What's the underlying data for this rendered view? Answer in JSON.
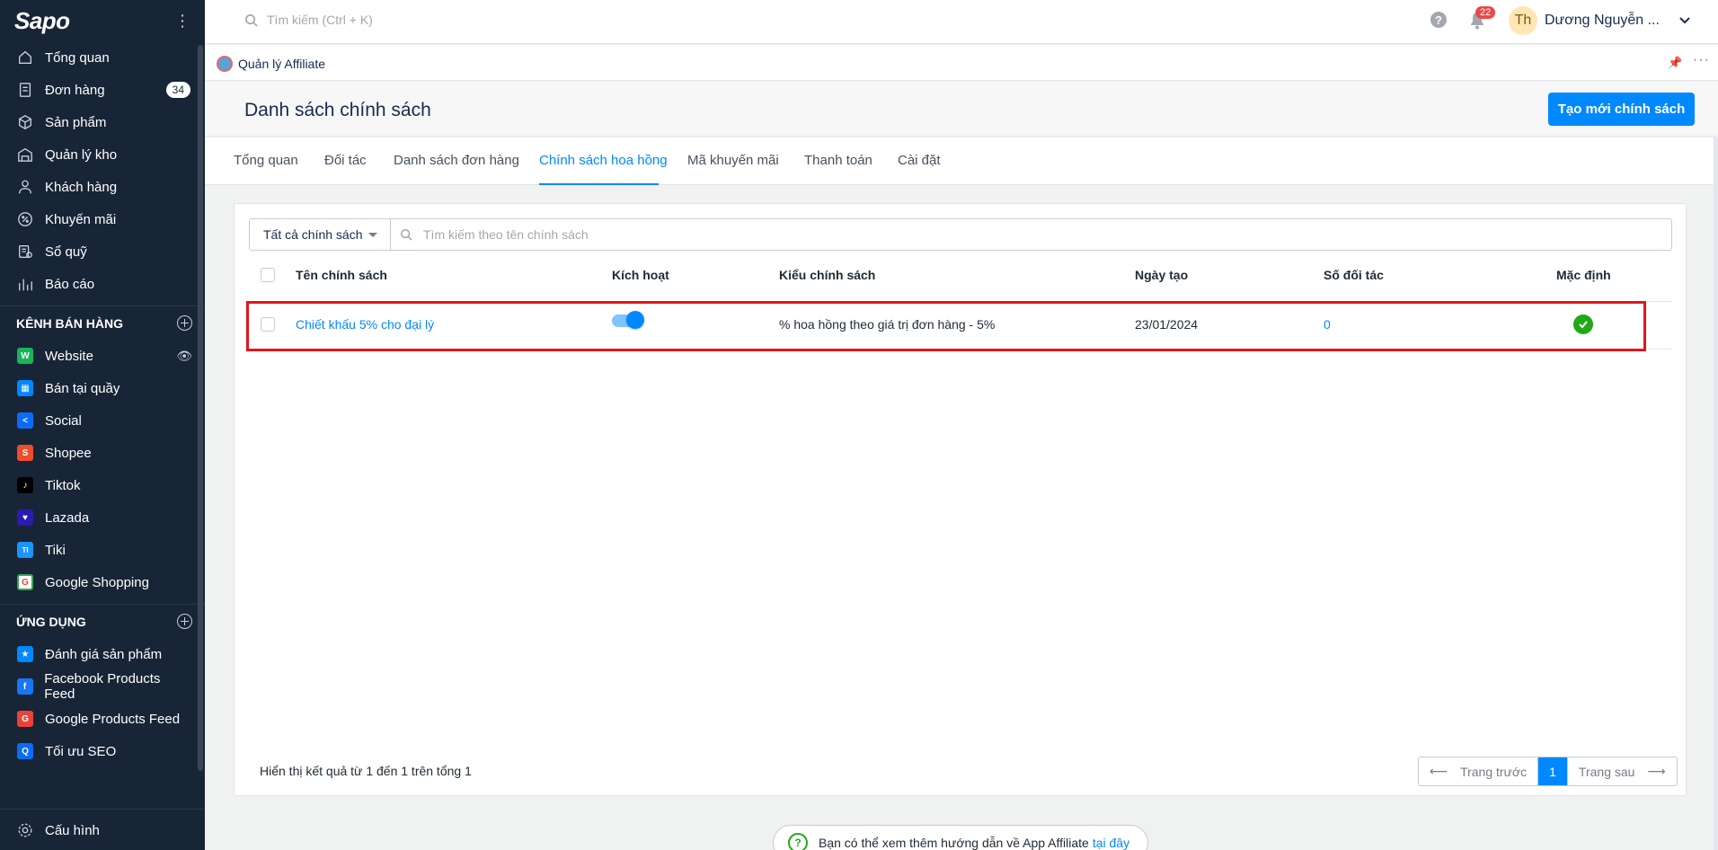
{
  "app": {
    "logo": "Sapo",
    "search_placeholder": "Tìm kiếm (Ctrl + K)"
  },
  "sidebar": {
    "main": [
      {
        "label": "Tổng quan",
        "icon": "home-icon"
      },
      {
        "label": "Đơn hàng",
        "icon": "order-icon",
        "badge": "34"
      },
      {
        "label": "Sản phẩm",
        "icon": "box-icon"
      },
      {
        "label": "Quản lý kho",
        "icon": "warehouse-icon"
      },
      {
        "label": "Khách hàng",
        "icon": "user-icon"
      },
      {
        "label": "Khuyến mãi",
        "icon": "discount-icon"
      },
      {
        "label": "Sổ quỹ",
        "icon": "cashbook-icon"
      },
      {
        "label": "Báo cáo",
        "icon": "chart-icon"
      }
    ],
    "channels_title": "KÊNH BÁN HÀNG",
    "channels": [
      {
        "label": "Website",
        "color": "#19b35a",
        "glyph": "W"
      },
      {
        "label": "Bán tại quầy",
        "color": "#0088ff",
        "glyph": "P"
      },
      {
        "label": "Social",
        "color": "#0a6cf5",
        "glyph": "<"
      },
      {
        "label": "Shopee",
        "color": "#ee4d2d",
        "glyph": "S"
      },
      {
        "label": "Tiktok",
        "color": "#000000",
        "glyph": "♪"
      },
      {
        "label": "Lazada",
        "color": "#2b1bb0",
        "glyph": "L"
      },
      {
        "label": "Tiki",
        "color": "#1a94ff",
        "glyph": "TI"
      },
      {
        "label": "Google Shopping",
        "color": "#ffffff",
        "glyph": "G"
      }
    ],
    "apps_title": "ỨNG DỤNG",
    "apps": [
      {
        "label": "Đánh giá sản phẩm",
        "color": "#0088ff",
        "glyph": "★"
      },
      {
        "label": "Facebook Products Feed",
        "color": "#1877f2",
        "glyph": "f"
      },
      {
        "label": "Google Products Feed",
        "color": "#ea4335",
        "glyph": "G"
      },
      {
        "label": "Tối ưu SEO",
        "color": "#0a6cf5",
        "glyph": "Q"
      }
    ],
    "settings": "Cấu hình"
  },
  "topbar": {
    "notifications": "22",
    "avatar": "Th",
    "user": "Dương Nguyễn ..."
  },
  "appbar": {
    "title": "Quản lý Affiliate"
  },
  "page": {
    "title": "Danh sách chính sách",
    "create_button": "Tạo mới chính sách"
  },
  "tabs": [
    "Tổng quan",
    "Đối tác",
    "Danh sách đơn hàng",
    "Chính sách hoa hồng",
    "Mã khuyến mãi",
    "Thanh toán",
    "Cài đặt"
  ],
  "active_tab": "Chính sách hoa hồng",
  "filter": {
    "dropdown": "Tất cả chính sách",
    "search_placeholder": "Tìm kiếm theo tên chính sách"
  },
  "table": {
    "headers": [
      "Tên chính sách",
      "Kích hoạt",
      "Kiểu chính sách",
      "Ngày tạo",
      "Số đối tác",
      "Mặc định"
    ],
    "rows": [
      {
        "name": "Chiết khấu 5% cho đại lý",
        "active": true,
        "type": "% hoa hồng theo giá trị đơn hàng - 5%",
        "created": "23/01/2024",
        "partners": "0",
        "default": true
      }
    ]
  },
  "pagination": {
    "summary": "Hiển thị kết quả từ 1 đến 1 trên tổng 1",
    "prev": "Trang trước",
    "current": "1",
    "next": "Trang sau"
  },
  "help_text": "Bạn có thể xem thêm hướng dẫn về App Affiliate",
  "help_link": "tại đây"
}
